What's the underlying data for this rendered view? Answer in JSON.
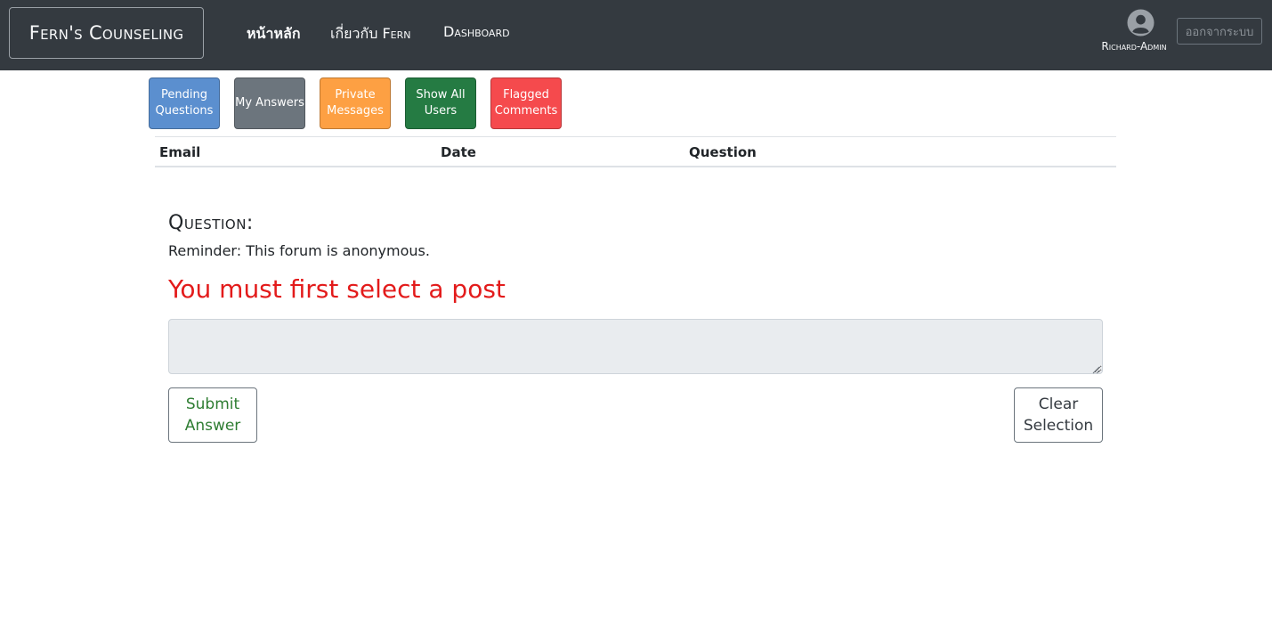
{
  "navbar": {
    "brand": "Fern's Counseling",
    "links": [
      "หน้าหลัก",
      "เกี่ยวกับ Fern",
      "Dashboard"
    ],
    "user_name": "Richard-Admin",
    "logout_label": "ออกจากระบบ",
    "user_icon": "user-circle-icon",
    "background": "#343a40"
  },
  "filters": [
    {
      "label": "Pending Questions",
      "color": "#5b8fcf"
    },
    {
      "label": "My Answers",
      "color": "#6c757d"
    },
    {
      "label": "Private Messages",
      "color": "#fda043"
    },
    {
      "label": "Show All Users",
      "color": "#257b43"
    },
    {
      "label": "Flagged Comments",
      "color": "#f54a4d"
    }
  ],
  "table": {
    "columns": [
      "Email",
      "Date",
      "Question"
    ],
    "rows": []
  },
  "question": {
    "heading": "Question:",
    "reminder": "Reminder: This forum is anonymous.",
    "error": "You must first select a post",
    "error_color": "#e31b1b",
    "answer_value": "",
    "submit_label": "Submit Answer",
    "clear_label": "Clear Selection"
  }
}
